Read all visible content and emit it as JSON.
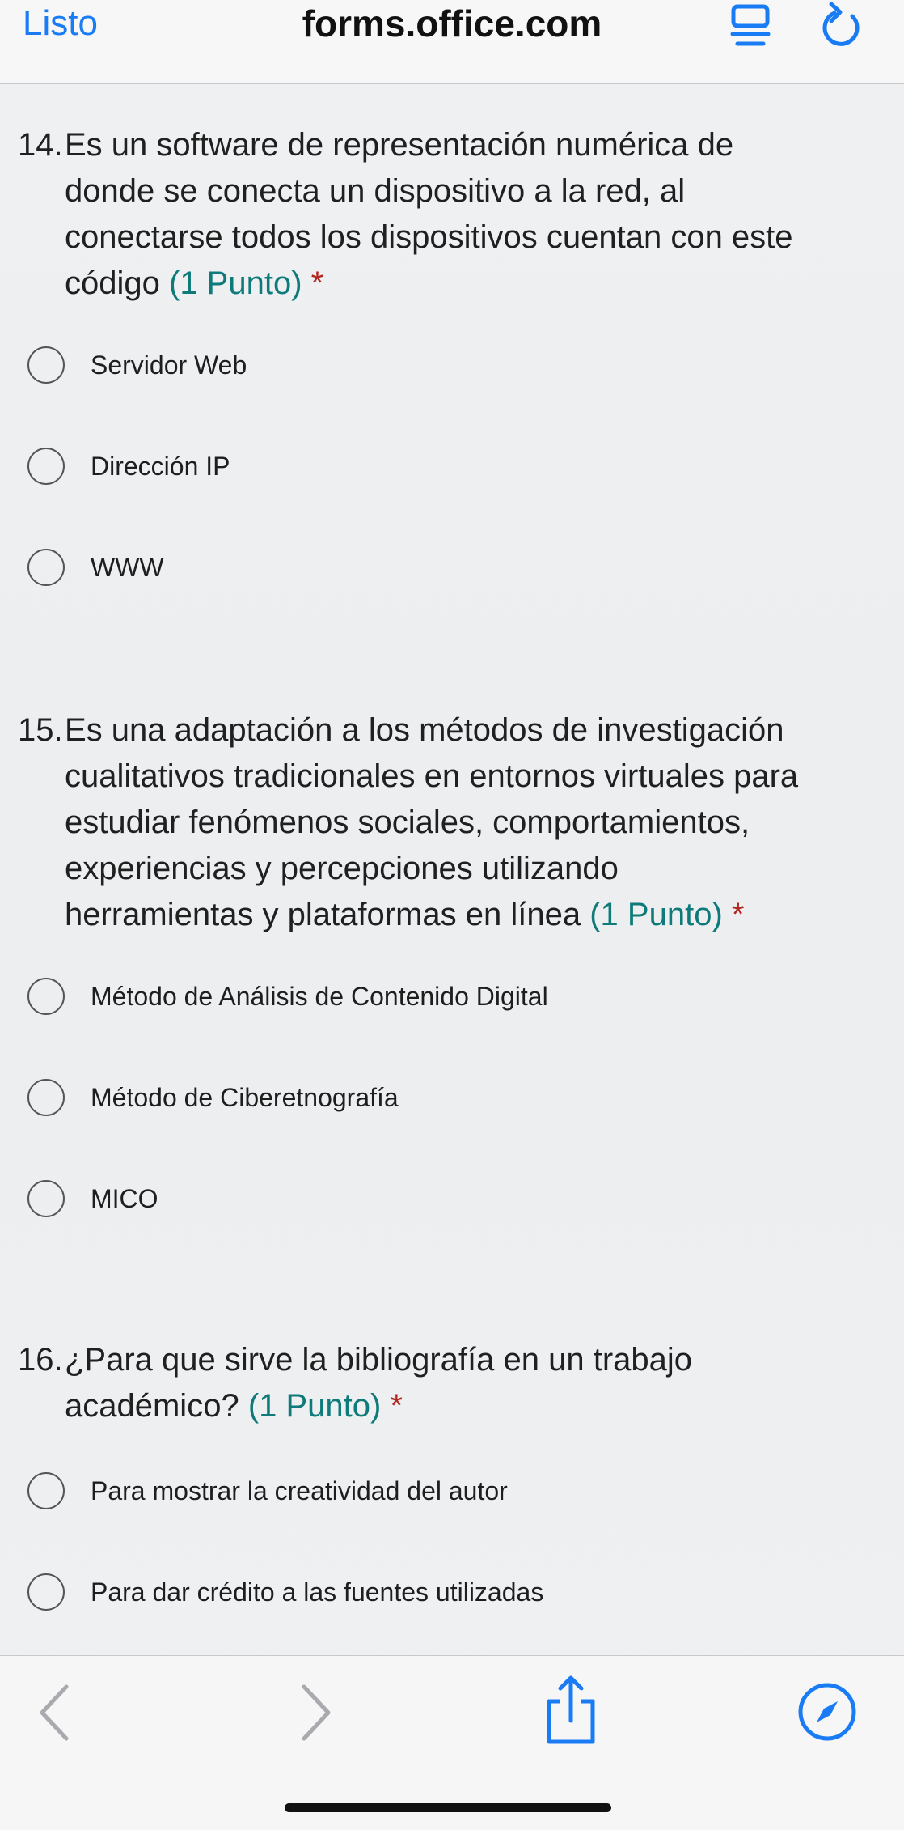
{
  "topbar": {
    "done_label": "Listo",
    "host": "forms.office.com"
  },
  "questions": [
    {
      "number": "14.",
      "lines": [
        "Es un software de representación numérica de",
        "donde se conecta un dispositivo a la red, al",
        "conectarse todos los dispositivos cuentan con este"
      ],
      "last_line": "código",
      "points": "(1 Punto)",
      "required": "*",
      "options": [
        "Servidor Web",
        "Dirección IP",
        "WWW"
      ]
    },
    {
      "number": "15.",
      "lines": [
        "Es una adaptación a los métodos de investigación",
        "cualitativos tradicionales en entornos virtuales para",
        "estudiar fenómenos sociales, comportamientos,",
        "experiencias y percepciones utilizando"
      ],
      "last_line": "herramientas y plataformas en línea",
      "points": "(1 Punto)",
      "required": "*",
      "options": [
        "Método de Análisis de Contenido Digital",
        "Método de Ciberetnografía",
        "MICO"
      ]
    },
    {
      "number": "16.",
      "lines": [
        "¿Para que sirve la bibliografía en un trabajo"
      ],
      "last_line": "académico?",
      "points": "(1 Punto)",
      "required": "*",
      "options": [
        "Para mostrar la creatividad del autor",
        "Para dar crédito a las fuentes utilizadas"
      ]
    }
  ],
  "toolbar": {
    "icons": [
      "chevron-left-icon",
      "chevron-right-icon",
      "share-icon",
      "compass-icon"
    ]
  },
  "colors": {
    "accent": "#1a7cf5",
    "points": "#0f7a7a",
    "required": "#b3261e"
  }
}
